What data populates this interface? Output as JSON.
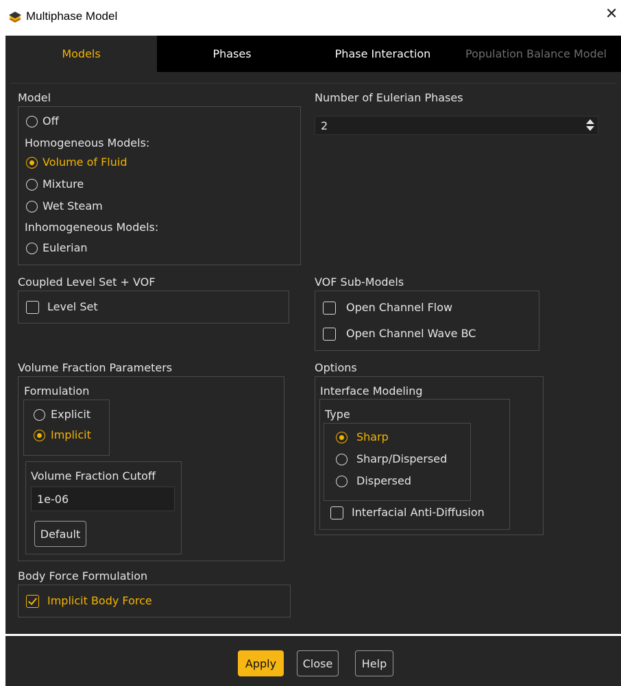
{
  "window": {
    "title": "Multiphase Model",
    "close_glyph": "✕"
  },
  "tabs": [
    {
      "label": "Models",
      "state": "active"
    },
    {
      "label": "Phases",
      "state": "normal"
    },
    {
      "label": "Phase Interaction",
      "state": "normal"
    },
    {
      "label": "Population Balance Model",
      "state": "disabled"
    }
  ],
  "model": {
    "group_label": "Model",
    "off": "Off",
    "homogeneous_heading": "Homogeneous Models:",
    "volume_of_fluid": "Volume of Fluid",
    "mixture": "Mixture",
    "wet_steam": "Wet Steam",
    "inhomogeneous_heading": "Inhomogeneous Models:",
    "eulerian": "Eulerian",
    "selected": "Volume of Fluid"
  },
  "eulerian_phases": {
    "label": "Number of Eulerian Phases",
    "value": "2"
  },
  "coupled_level_set": {
    "group_label": "Coupled Level Set + VOF",
    "level_set": "Level Set",
    "level_set_checked": false
  },
  "vof_sub_models": {
    "group_label": "VOF Sub-Models",
    "open_channel_flow": "Open Channel Flow",
    "open_channel_wave_bc": "Open Channel Wave BC",
    "open_channel_flow_checked": false,
    "open_channel_wave_bc_checked": false
  },
  "volume_fraction": {
    "group_label": "Volume Fraction Parameters",
    "formulation_label": "Formulation",
    "explicit": "Explicit",
    "implicit": "Implicit",
    "selected": "Implicit",
    "cutoff_label": "Volume Fraction Cutoff",
    "cutoff_value": "1e-06",
    "default_button": "Default"
  },
  "options": {
    "group_label": "Options",
    "interface_modeling_label": "Interface Modeling",
    "type_label": "Type",
    "sharp": "Sharp",
    "sharp_dispersed": "Sharp/Dispersed",
    "dispersed": "Dispersed",
    "selected": "Sharp",
    "anti_diffusion": "Interfacial Anti-Diffusion",
    "anti_diffusion_checked": false
  },
  "body_force": {
    "group_label": "Body Force Formulation",
    "implicit_body_force": "Implicit Body Force",
    "checked": true
  },
  "footer": {
    "apply": "Apply",
    "close": "Close",
    "help": "Help"
  },
  "colors": {
    "accent": "#f4b400",
    "panel_bg": "#262626",
    "tab_bar_bg": "#000000",
    "apply_bg": "#f6b614"
  }
}
